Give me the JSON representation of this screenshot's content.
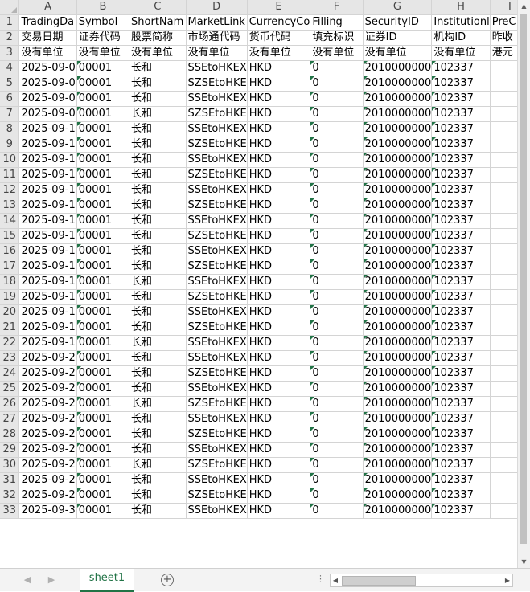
{
  "columns": [
    "A",
    "B",
    "C",
    "D",
    "E",
    "F",
    "G",
    "H",
    "I"
  ],
  "rows": [
    [
      "TradingDa",
      "Symbol",
      "ShortNam",
      "MarketLink",
      "CurrencyCo",
      "Filling",
      "SecurityID",
      "Institutionl",
      "PreC"
    ],
    [
      "交易日期",
      "证券代码",
      "股票简称",
      "市场通代码",
      "货币代码",
      "填充标识",
      "证券ID",
      "机构ID",
      "昨收"
    ],
    [
      "没有单位",
      "没有单位",
      "没有单位",
      "没有单位",
      "没有单位",
      "没有单位",
      "没有单位",
      "没有单位",
      "港元"
    ],
    [
      "2025-09-0",
      "00001",
      "长和",
      "SSEtoHKEX",
      "HKD",
      "0",
      "2010000000",
      "102337",
      ""
    ],
    [
      "2025-09-0",
      "00001",
      "长和",
      "SZSEtoHKE",
      "HKD",
      "0",
      "2010000000",
      "102337",
      ""
    ],
    [
      "2025-09-0",
      "00001",
      "长和",
      "SSEtoHKEX",
      "HKD",
      "0",
      "2010000000",
      "102337",
      ""
    ],
    [
      "2025-09-0",
      "00001",
      "长和",
      "SZSEtoHKE",
      "HKD",
      "0",
      "2010000000",
      "102337",
      ""
    ],
    [
      "2025-09-1",
      "00001",
      "长和",
      "SSEtoHKEX",
      "HKD",
      "0",
      "2010000000",
      "102337",
      ""
    ],
    [
      "2025-09-1",
      "00001",
      "长和",
      "SZSEtoHKE",
      "HKD",
      "0",
      "2010000000",
      "102337",
      ""
    ],
    [
      "2025-09-1",
      "00001",
      "长和",
      "SSEtoHKEX",
      "HKD",
      "0",
      "2010000000",
      "102337",
      ""
    ],
    [
      "2025-09-1",
      "00001",
      "长和",
      "SZSEtoHKE",
      "HKD",
      "0",
      "2010000000",
      "102337",
      ""
    ],
    [
      "2025-09-1",
      "00001",
      "长和",
      "SSEtoHKEX",
      "HKD",
      "0",
      "2010000000",
      "102337",
      ""
    ],
    [
      "2025-09-1",
      "00001",
      "长和",
      "SZSEtoHKE",
      "HKD",
      "0",
      "2010000000",
      "102337",
      ""
    ],
    [
      "2025-09-1",
      "00001",
      "长和",
      "SSEtoHKEX",
      "HKD",
      "0",
      "2010000000",
      "102337",
      ""
    ],
    [
      "2025-09-1",
      "00001",
      "长和",
      "SZSEtoHKE",
      "HKD",
      "0",
      "2010000000",
      "102337",
      ""
    ],
    [
      "2025-09-1",
      "00001",
      "长和",
      "SSEtoHKEX",
      "HKD",
      "0",
      "2010000000",
      "102337",
      ""
    ],
    [
      "2025-09-1",
      "00001",
      "长和",
      "SZSEtoHKE",
      "HKD",
      "0",
      "2010000000",
      "102337",
      ""
    ],
    [
      "2025-09-1",
      "00001",
      "长和",
      "SSEtoHKEX",
      "HKD",
      "0",
      "2010000000",
      "102337",
      ""
    ],
    [
      "2025-09-1",
      "00001",
      "长和",
      "SZSEtoHKE",
      "HKD",
      "0",
      "2010000000",
      "102337",
      ""
    ],
    [
      "2025-09-1",
      "00001",
      "长和",
      "SSEtoHKEX",
      "HKD",
      "0",
      "2010000000",
      "102337",
      ""
    ],
    [
      "2025-09-1",
      "00001",
      "长和",
      "SZSEtoHKE",
      "HKD",
      "0",
      "2010000000",
      "102337",
      ""
    ],
    [
      "2025-09-1",
      "00001",
      "长和",
      "SSEtoHKEX",
      "HKD",
      "0",
      "2010000000",
      "102337",
      ""
    ],
    [
      "2025-09-2",
      "00001",
      "长和",
      "SSEtoHKEX",
      "HKD",
      "0",
      "2010000000",
      "102337",
      ""
    ],
    [
      "2025-09-2",
      "00001",
      "长和",
      "SZSEtoHKE",
      "HKD",
      "0",
      "2010000000",
      "102337",
      ""
    ],
    [
      "2025-09-2",
      "00001",
      "长和",
      "SSEtoHKEX",
      "HKD",
      "0",
      "2010000000",
      "102337",
      ""
    ],
    [
      "2025-09-2",
      "00001",
      "长和",
      "SZSEtoHKE",
      "HKD",
      "0",
      "2010000000",
      "102337",
      ""
    ],
    [
      "2025-09-2",
      "00001",
      "长和",
      "SSEtoHKEX",
      "HKD",
      "0",
      "2010000000",
      "102337",
      ""
    ],
    [
      "2025-09-2",
      "00001",
      "长和",
      "SZSEtoHKE",
      "HKD",
      "0",
      "2010000000",
      "102337",
      ""
    ],
    [
      "2025-09-2",
      "00001",
      "长和",
      "SSEtoHKEX",
      "HKD",
      "0",
      "2010000000",
      "102337",
      ""
    ],
    [
      "2025-09-2",
      "00001",
      "长和",
      "SZSEtoHKE",
      "HKD",
      "0",
      "2010000000",
      "102337",
      ""
    ],
    [
      "2025-09-2",
      "00001",
      "长和",
      "SSEtoHKEX",
      "HKD",
      "0",
      "2010000000",
      "102337",
      ""
    ],
    [
      "2025-09-2",
      "00001",
      "长和",
      "SZSEtoHKE",
      "HKD",
      "0",
      "2010000000",
      "102337",
      ""
    ],
    [
      "2025-09-3",
      "00001",
      "长和",
      "SSEtoHKEX",
      "HKD",
      "0",
      "2010000000",
      "102337",
      ""
    ]
  ],
  "sheet_tabs": [
    {
      "label": "sheet1",
      "active": true
    }
  ],
  "bottom": {
    "add_sheet_icon": "+",
    "more_icon": "⋮",
    "prev_icon": "◀",
    "next_icon": "▶"
  },
  "colors": {
    "accent": "#217346",
    "header_bg": "#e6e6e6",
    "gridline": "#d4d4d4"
  }
}
